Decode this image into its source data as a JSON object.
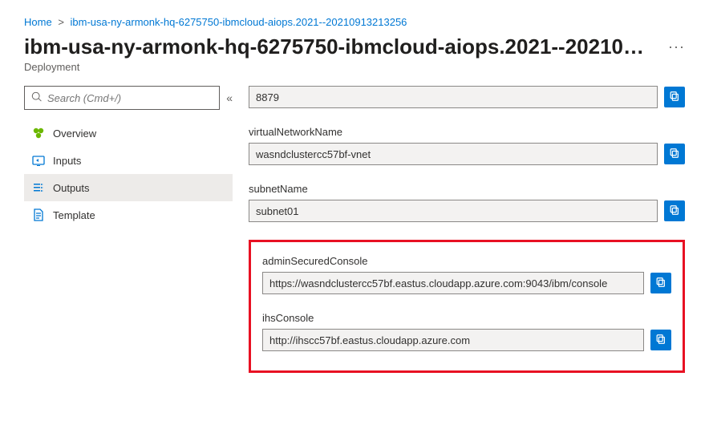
{
  "breadcrumb": {
    "home": "Home",
    "current": "ibm-usa-ny-armonk-hq-6275750-ibmcloud-aiops.2021--20210913213256"
  },
  "title": "ibm-usa-ny-armonk-hq-6275750-ibmcloud-aiops.2021--20210…",
  "subtitle": "Deployment",
  "search": {
    "placeholder": "Search (Cmd+/)"
  },
  "sidebar": {
    "items": [
      {
        "label": "Overview"
      },
      {
        "label": "Inputs"
      },
      {
        "label": "Outputs"
      },
      {
        "label": "Template"
      }
    ]
  },
  "outputs": [
    {
      "label": "",
      "value": "8879"
    },
    {
      "label": "virtualNetworkName",
      "value": "wasndclustercc57bf-vnet"
    },
    {
      "label": "subnetName",
      "value": "subnet01"
    },
    {
      "label": "adminSecuredConsole",
      "value": "https://wasndclustercc57bf.eastus.cloudapp.azure.com:9043/ibm/console"
    },
    {
      "label": "ihsConsole",
      "value": "http://ihscc57bf.eastus.cloudapp.azure.com"
    }
  ]
}
